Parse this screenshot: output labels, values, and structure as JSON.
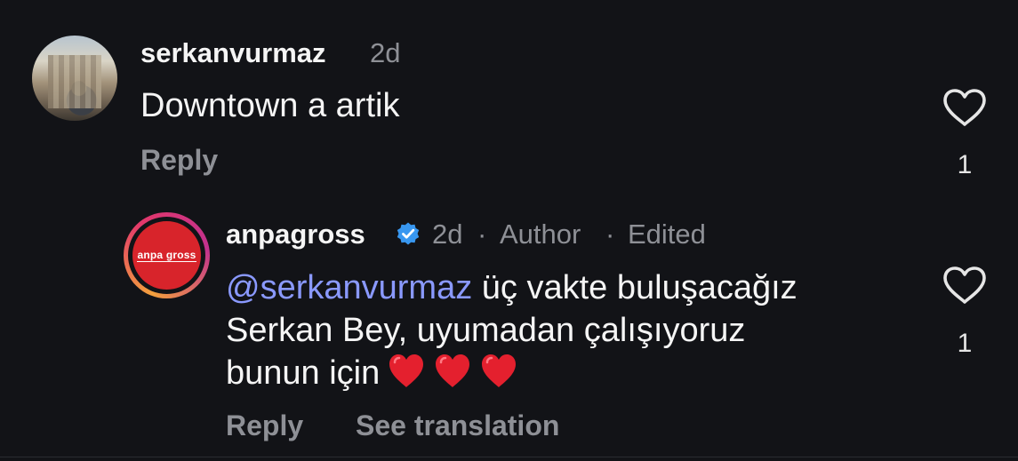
{
  "comments": [
    {
      "username": "serkanvurmaz",
      "time": "2d",
      "text": "Downtown a artik",
      "reply_label": "Reply",
      "like_count": "1",
      "avatar_icon": "profile-photo"
    },
    {
      "username": "anpagross",
      "time": "2d",
      "author_badge": "Author",
      "edited_label": "Edited",
      "separator": "·",
      "mention": "@serkanvurmaz",
      "text_line1": "üç vakte buluşacağız",
      "text_line2": "Serkan Bey, uyumadan çalışıyoruz",
      "text_line3": "bunun için",
      "reply_label": "Reply",
      "translate_label": "See translation",
      "like_count": "1",
      "avatar_logo_text": "anpa gross",
      "verified_icon": "verified-badge",
      "emoji_icon": "red-heart",
      "emoji_count": 3
    }
  ],
  "colors": {
    "background": "#121317",
    "mention": "#8a99ff",
    "secondary_text": "#8e9096",
    "verified": "#3897f0",
    "heart": "#e4202e"
  }
}
